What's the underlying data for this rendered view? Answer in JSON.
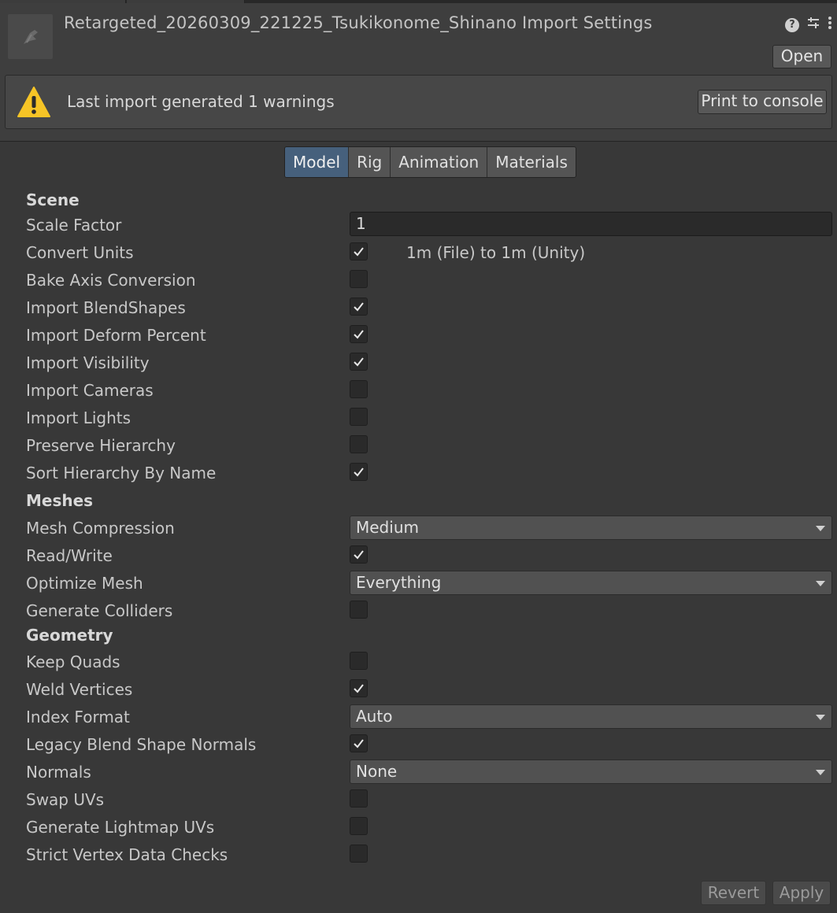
{
  "header": {
    "title": "Retargeted_20260309_221225_Tsukikonome_Shinano Import Settings",
    "open_label": "Open",
    "icons": [
      "help-icon",
      "preset-icon",
      "more-menu-icon"
    ]
  },
  "warning": {
    "text": "Last import generated 1 warnings",
    "button_label": "Print to console",
    "icon": "warning-icon"
  },
  "tabs": [
    {
      "label": "Model",
      "active": true
    },
    {
      "label": "Rig",
      "active": false
    },
    {
      "label": "Animation",
      "active": false
    },
    {
      "label": "Materials",
      "active": false
    }
  ],
  "sections": {
    "scene": "Scene",
    "meshes": "Meshes",
    "geometry": "Geometry"
  },
  "fields": {
    "scale_factor": {
      "label": "Scale Factor",
      "value": "1"
    },
    "convert_units": {
      "label": "Convert Units",
      "checked": true,
      "note": "1m (File) to 1m (Unity)"
    },
    "bake_axis": {
      "label": "Bake Axis Conversion",
      "checked": false
    },
    "import_blendshapes": {
      "label": "Import BlendShapes",
      "checked": true
    },
    "import_deform_percent": {
      "label": "Import Deform Percent",
      "checked": true
    },
    "import_visibility": {
      "label": "Import Visibility",
      "checked": true
    },
    "import_cameras": {
      "label": "Import Cameras",
      "checked": false
    },
    "import_lights": {
      "label": "Import Lights",
      "checked": false
    },
    "preserve_hierarchy": {
      "label": "Preserve Hierarchy",
      "checked": false
    },
    "sort_hierarchy": {
      "label": "Sort Hierarchy By Name",
      "checked": true
    },
    "mesh_compression": {
      "label": "Mesh Compression",
      "value": "Medium"
    },
    "read_write": {
      "label": "Read/Write",
      "checked": true
    },
    "optimize_mesh": {
      "label": "Optimize Mesh",
      "value": "Everything"
    },
    "generate_colliders": {
      "label": "Generate Colliders",
      "checked": false
    },
    "keep_quads": {
      "label": "Keep Quads",
      "checked": false
    },
    "weld_vertices": {
      "label": "Weld Vertices",
      "checked": true
    },
    "index_format": {
      "label": "Index Format",
      "value": "Auto"
    },
    "legacy_blend_normals": {
      "label": "Legacy Blend Shape Normals",
      "checked": true
    },
    "normals": {
      "label": "Normals",
      "value": "None"
    },
    "swap_uvs": {
      "label": "Swap UVs",
      "checked": false
    },
    "generate_lightmap_uvs": {
      "label": "Generate Lightmap UVs",
      "checked": false
    },
    "strict_vertex_checks": {
      "label": "Strict Vertex Data Checks",
      "checked": false
    }
  },
  "footer": {
    "revert_label": "Revert",
    "apply_label": "Apply"
  }
}
